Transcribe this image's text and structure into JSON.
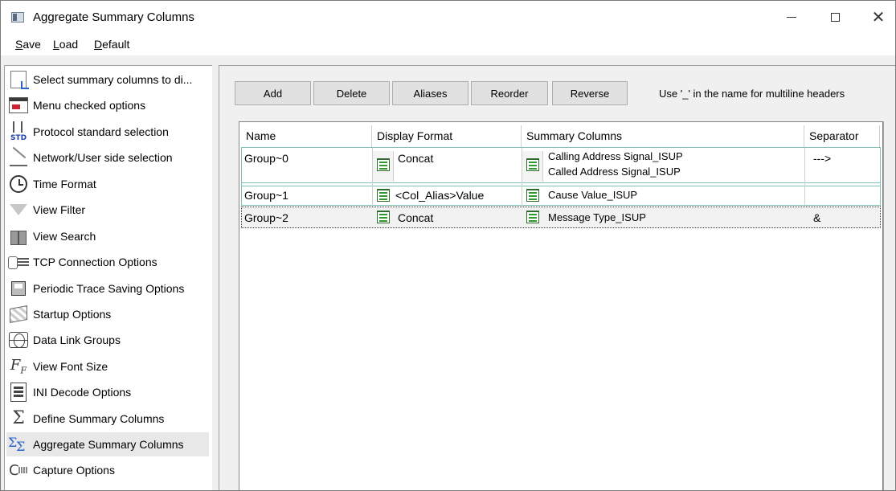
{
  "window": {
    "title": "Aggregate Summary Columns"
  },
  "menu": {
    "save_underlined": "S",
    "save_rest": "ave",
    "load_underlined": "L",
    "load_rest": "oad",
    "default_underlined": "D",
    "default_rest": "efault"
  },
  "sidebar": {
    "items": [
      {
        "label": "Select summary columns to di...",
        "icon": "summary-doc-icon"
      },
      {
        "label": "Menu checked options",
        "icon": "menu-icon"
      },
      {
        "label": "Protocol standard selection",
        "icon": "std-icon"
      },
      {
        "label": "Network/User side selection",
        "icon": "network-icon"
      },
      {
        "label": "Time Format",
        "icon": "clock-icon"
      },
      {
        "label": "View Filter",
        "icon": "funnel-icon"
      },
      {
        "label": "View Search",
        "icon": "binoculars-icon"
      },
      {
        "label": "TCP Connection Options",
        "icon": "tcp-icon"
      },
      {
        "label": "Periodic Trace Saving Options",
        "icon": "save-icon"
      },
      {
        "label": "Startup Options",
        "icon": "flag-icon"
      },
      {
        "label": "Data Link Groups",
        "icon": "globe-icon"
      },
      {
        "label": "View Font Size",
        "icon": "font-size-icon"
      },
      {
        "label": "INI Decode Options",
        "icon": "ini-icon"
      },
      {
        "label": "Define Summary Columns",
        "icon": "sigma-icon"
      },
      {
        "label": "Aggregate Summary Columns",
        "icon": "aggregate-icon"
      },
      {
        "label": "Capture Options",
        "icon": "capture-icon"
      }
    ],
    "selected_index": 14
  },
  "toolbar": {
    "add": "Add",
    "delete": "Delete",
    "aliases": "Aliases",
    "reorder": "Reorder",
    "reverse": "Reverse",
    "hint": "Use '_' in the name for multiline headers"
  },
  "grid": {
    "headers": [
      "Name",
      "Display Format",
      "Summary Columns",
      "Separator"
    ],
    "rows": [
      {
        "name": "Group~0",
        "format": "Concat",
        "summary_line1": "Calling Address Signal_ISUP",
        "summary_line2": "Called Address Signal_ISUP",
        "separator": "--->"
      },
      {
        "name": "Group~1",
        "format": "<Col_Alias>Value",
        "summary_line1": "Cause Value_ISUP",
        "summary_line2": "",
        "separator": ""
      },
      {
        "name": "Group~2",
        "format": "Concat",
        "summary_line1": "Message Type_ISUP",
        "summary_line2": "",
        "separator": "&"
      }
    ]
  },
  "colors": {
    "row_border": "#7fc0b6",
    "selection_bg": "#e8e8e8",
    "button_bg": "#e1e1e1"
  }
}
